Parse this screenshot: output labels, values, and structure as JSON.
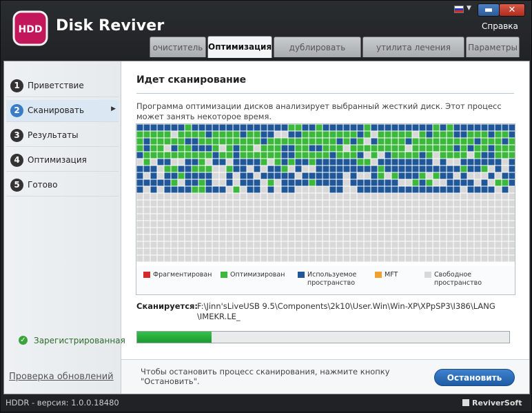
{
  "window": {
    "app_title": "Disk Reviver",
    "logo_text": "HDD",
    "minimize_glyph": "▬",
    "close_glyph": "✕",
    "help": "Справка",
    "flag_icon": "russian-flag-icon"
  },
  "tabs": [
    {
      "label": "очиститель",
      "active": false
    },
    {
      "label": "Оптимизация",
      "active": true
    },
    {
      "label": "дублировать Файлы",
      "active": false
    },
    {
      "label": "утилита лечения диска",
      "active": false
    },
    {
      "label": "Параметры",
      "active": false
    }
  ],
  "sidebar": {
    "steps": [
      {
        "num": "1",
        "label": "Приветствие"
      },
      {
        "num": "2",
        "label": "Сканировать"
      },
      {
        "num": "3",
        "label": "Результаты"
      },
      {
        "num": "4",
        "label": "Оптимизация"
      },
      {
        "num": "5",
        "label": "Готово"
      }
    ],
    "active_step": 2,
    "registered": "Зарегистрированная",
    "update_link": "Проверка обновлений"
  },
  "main": {
    "title": "Идет сканирование",
    "description": "Программа оптимизации дисков анализирует выбранный жесткий диск. Этот процесс может занять некоторое время.",
    "legend": [
      {
        "label": "Фрагментирован",
        "color": "#d42a2a"
      },
      {
        "label": "Оптимизирован",
        "color": "#3cb83c"
      },
      {
        "label": "Используемое пространство",
        "color": "#1f5799"
      },
      {
        "label": "MFT",
        "color": "#f0a030"
      },
      {
        "label": "Свободное пространство",
        "color": "#d8d8d8"
      }
    ],
    "scanning_label": "Сканируется:",
    "scanning_path": "F:\\Jinn'sLiveUSB 9.5\\Components\\2k10\\User.Win\\Win-XP\\XPpSP3\\I386\\LANG\\IMEKR.LE_",
    "progress": 0.2,
    "stop_hint": "Чтобы остановить процесс сканирования, нажмите кнопку \"Остановить\".",
    "stop_button": "Остановить"
  },
  "status_bar": {
    "version": "HDDR - версия: 1.0.0.18480",
    "brand": "ReviverSoft"
  }
}
